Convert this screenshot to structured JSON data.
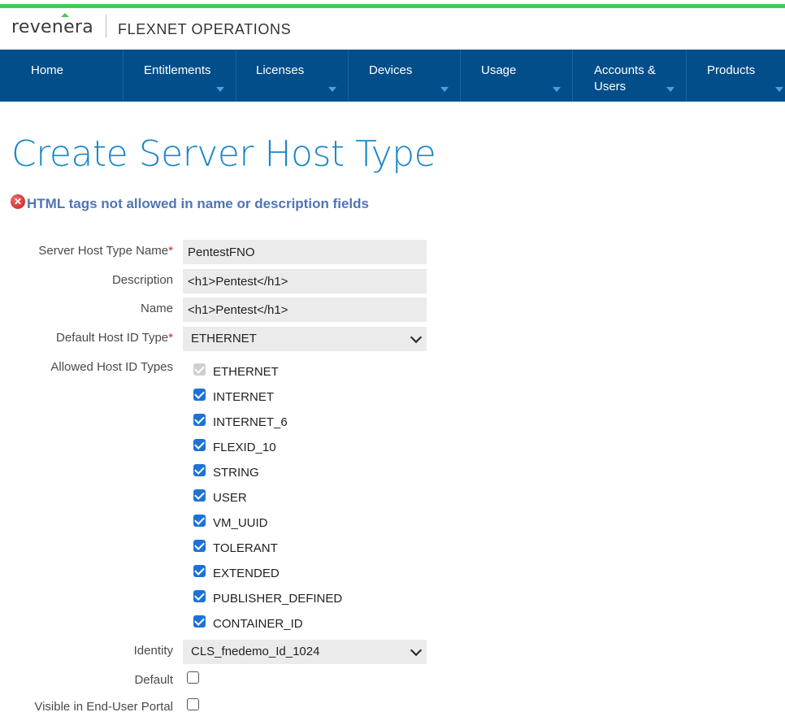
{
  "brand": {
    "logo_text": "revenera",
    "product": "FLEXNET OPERATIONS"
  },
  "nav": [
    {
      "label": "Home",
      "label2": "",
      "has_menu": false
    },
    {
      "label": "Entitlements",
      "label2": "",
      "has_menu": true
    },
    {
      "label": "Licenses",
      "label2": "",
      "has_menu": true
    },
    {
      "label": "Devices",
      "label2": "",
      "has_menu": true
    },
    {
      "label": "Usage",
      "label2": "",
      "has_menu": true
    },
    {
      "label": "Accounts &",
      "label2": "Users",
      "has_menu": true
    },
    {
      "label": "Products",
      "label2": "",
      "has_menu": true
    }
  ],
  "page_title": "Create Server Host Type",
  "error_message": "HTML tags not allowed in name or description fields",
  "form": {
    "name_label": "Server Host Type Name",
    "name_value": "PentestFNO",
    "description_label": "Description",
    "description_value": "<h1>Pentest</h1>",
    "display_name_label": "Name",
    "display_name_value": "<h1>Pentest</h1>",
    "default_host_id_label": "Default Host ID Type",
    "default_host_id_value": "ETHERNET",
    "allowed_host_label": "Allowed Host ID Types",
    "allowed_host_types": [
      {
        "label": "ETHERNET",
        "checked": true,
        "disabled": true
      },
      {
        "label": "INTERNET",
        "checked": true,
        "disabled": false
      },
      {
        "label": "INTERNET_6",
        "checked": true,
        "disabled": false
      },
      {
        "label": "FLEXID_10",
        "checked": true,
        "disabled": false
      },
      {
        "label": "STRING",
        "checked": true,
        "disabled": false
      },
      {
        "label": "USER",
        "checked": true,
        "disabled": false
      },
      {
        "label": "VM_UUID",
        "checked": true,
        "disabled": false
      },
      {
        "label": "TOLERANT",
        "checked": true,
        "disabled": false
      },
      {
        "label": "EXTENDED",
        "checked": true,
        "disabled": false
      },
      {
        "label": "PUBLISHER_DEFINED",
        "checked": true,
        "disabled": false
      },
      {
        "label": "CONTAINER_ID",
        "checked": true,
        "disabled": false
      }
    ],
    "identity_label": "Identity",
    "identity_value": "CLS_fnedemo_Id_1024",
    "default_label": "Default",
    "default_checked": false,
    "visible_label": "Visible in End-User Portal",
    "visible_checked": false,
    "required_marker": "*"
  },
  "colors": {
    "accent_green": "#3ecc55",
    "nav_bg": "#014e8a",
    "title_blue": "#1a87c6",
    "error_text": "#4f75b4",
    "checkbox_blue": "#1e72d6"
  }
}
